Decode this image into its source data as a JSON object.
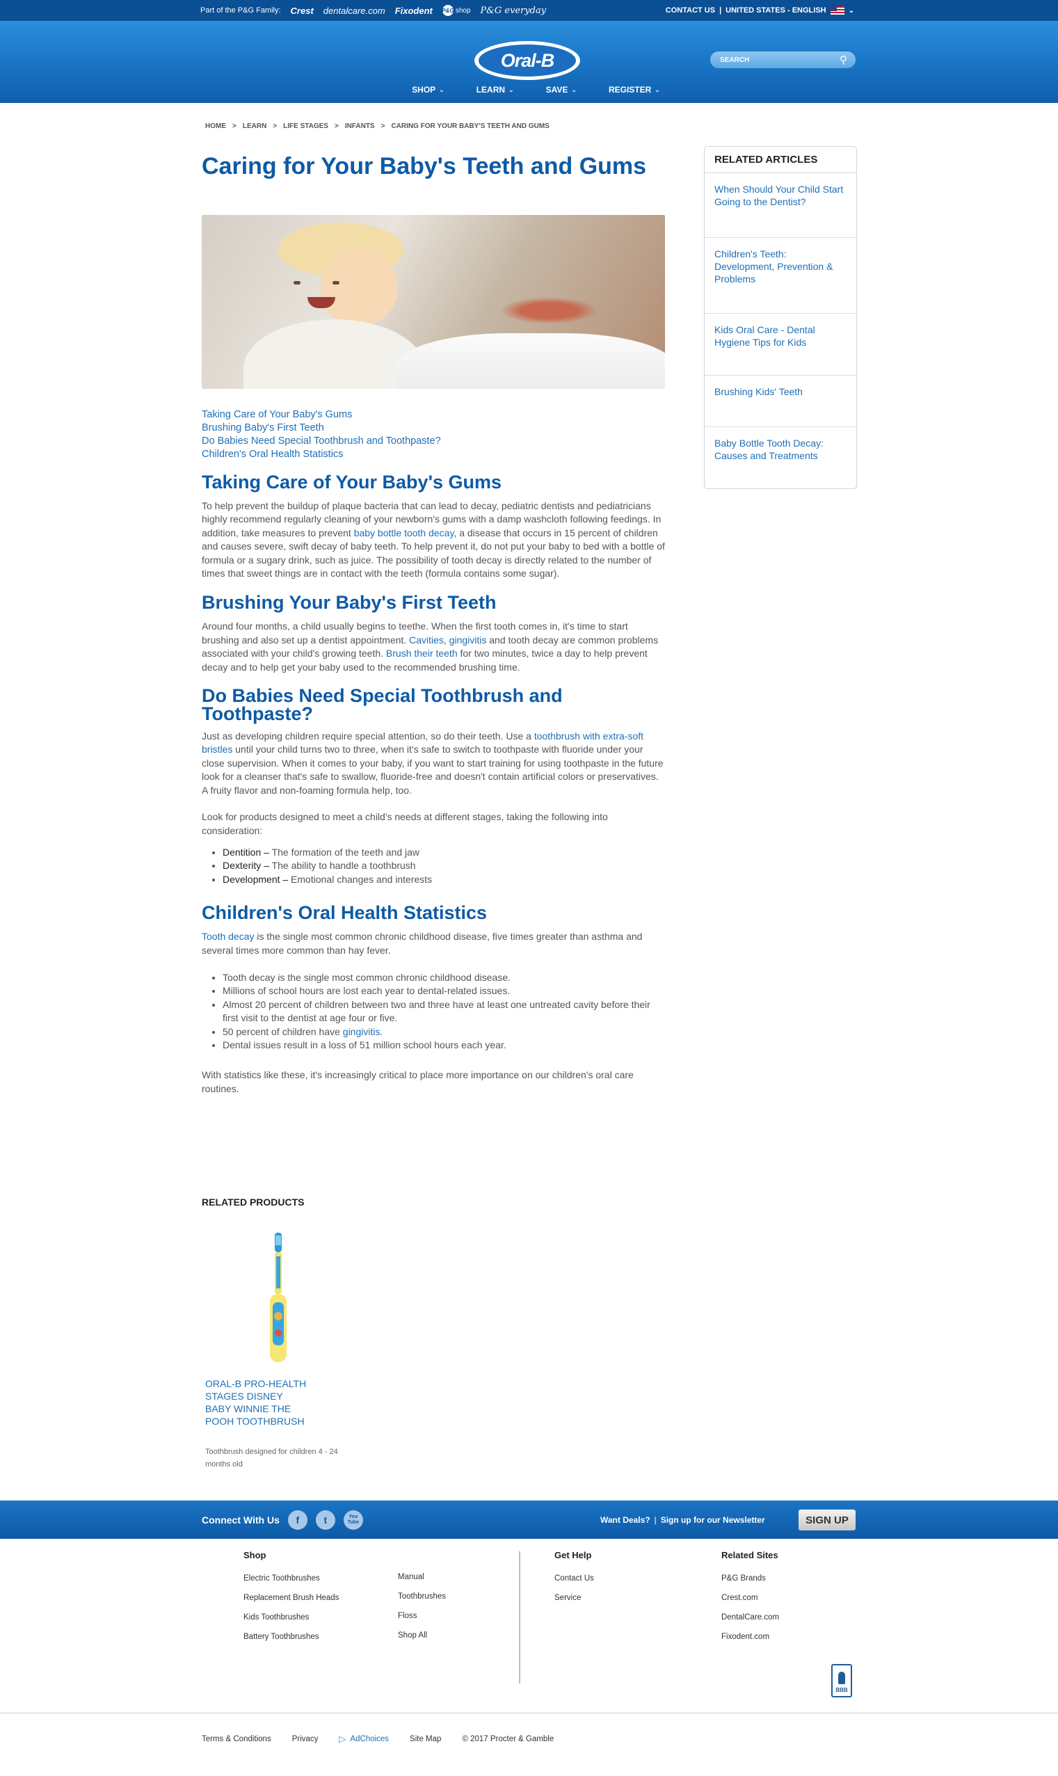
{
  "topbar": {
    "family_label": "Part of the P&G Family:",
    "brands": [
      "Crest",
      "dentalcare.com",
      "Fixodent",
      "P&G shop",
      "P&G everyday"
    ],
    "contact": "CONTACT US",
    "separator": "|",
    "region": "UNITED STATES - ENGLISH"
  },
  "header": {
    "logo": "Oral-B",
    "search_placeholder": "SEARCH",
    "nav": [
      "SHOP",
      "LEARN",
      "SAVE",
      "REGISTER"
    ]
  },
  "breadcrumb": [
    "HOME",
    ">",
    "LEARN",
    ">",
    "LIFE STAGES",
    ">",
    "INFANTS",
    ">",
    "CARING FOR YOUR BABY'S TEETH AND GUMS"
  ],
  "article": {
    "title": "Caring for Your Baby's Teeth and Gums",
    "toc": [
      "Taking Care of Your Baby's Gums",
      "Brushing Baby's First Teeth",
      "Do Babies Need Special Toothbrush and Toothpaste?",
      "Children's Oral Health Statistics"
    ],
    "s1": {
      "heading": "Taking Care of Your Baby's Gums",
      "p_a": "To help prevent the buildup of plaque bacteria that can lead to decay, pediatric dentists and pediatricians highly recommend regularly cleaning of your newborn's gums with a damp washcloth following feedings. In addition, take measures to prevent ",
      "link": "baby bottle tooth decay",
      "p_b": ", a disease that occurs in 15 percent of children and causes severe, swift decay of baby teeth. To help prevent it, do not put your baby to bed with a bottle of formula or a sugary drink, such as juice. The possibility of tooth decay is directly related to the number of times that sweet things are in contact with the teeth (formula contains some sugar)."
    },
    "s2": {
      "heading": "Brushing Your Baby's First Teeth",
      "p_a": "Around four months, a child usually begins to teethe. When the first tooth comes in, it's time to start brushing and also set up a dentist appointment. ",
      "link1": "Cavities",
      "comma": ", ",
      "link2": "gingivitis",
      "p_b": " and tooth decay are common problems associated with your child's growing teeth. ",
      "link3": "Brush their teeth",
      "p_c": " for two minutes, twice a day to help prevent decay and to help get your baby used to the recommended brushing time."
    },
    "s3": {
      "heading": "Do Babies Need Special Toothbrush and Toothpaste?",
      "p_a": "Just as developing children require special attention, so do their teeth. Use a ",
      "link": "toothbrush with extra-soft bristles",
      "p_b": " until your child turns two to three, when it's safe to switch to toothpaste with fluoride under your close supervision. When it comes to your baby, if you want to start training for using toothpaste in the future look for a cleanser that's safe to swallow, fluoride-free and doesn't contain artificial colors or preservatives. A fruity flavor and non-foaming formula help, too.",
      "p2": "Look for products designed to meet a child's needs at different stages, taking the following into consideration:",
      "bullets": [
        {
          "term": "Dentition –",
          "text": " The formation of the teeth and jaw"
        },
        {
          "term": "Dexterity –",
          "text": " The ability to handle a toothbrush"
        },
        {
          "term": "Development –",
          "text": " Emotional changes and interests"
        }
      ]
    },
    "s4": {
      "heading": "Children's Oral Health Statistics",
      "link": "Tooth decay",
      "p_a": " is the single most common chronic childhood disease, five times greater than asthma and several times more common than hay fever.",
      "bullets": [
        "Tooth decay is the single most common chronic childhood disease.",
        "Millions of school hours are lost each year to dental-related issues.",
        "Almost 20 percent of children between two and three have at least one untreated cavity before their first visit to the dentist at age four or five."
      ],
      "b4_a": "50 percent of children have ",
      "b4_link": "gingivitis",
      "b4_b": ".",
      "b5": "Dental issues result in a loss of 51 million school hours each year.",
      "closing": "With statistics like these, it's increasingly critical to place more importance on our children's oral care routines."
    }
  },
  "related_products": {
    "title": "RELATED PRODUCTS",
    "name": "ORAL-B PRO-HEALTH STAGES DISNEY BABY WINNIE THE POOH TOOTHBRUSH",
    "desc": "Toothbrush designed for children 4 - 24 months old"
  },
  "sidebar": {
    "title": "RELATED ARTICLES",
    "items": [
      "When Should Your Child Start Going to the Dentist?",
      "Children's Teeth: Development, Prevention & Problems",
      "Kids Oral Care - Dental Hygiene Tips for Kids",
      "Brushing Kids' Teeth",
      "Baby Bottle Tooth Decay: Causes and Treatments"
    ]
  },
  "footer": {
    "connect": "Connect With Us",
    "social": [
      "f",
      "t",
      "You Tube"
    ],
    "want_deals": "Want Deals?",
    "sep": "|",
    "newsletter": "Sign up for our Newsletter",
    "signup": "SIGN UP",
    "shop_title": "Shop",
    "shop_col1": [
      "Electric Toothbrushes",
      "Replacement Brush Heads",
      "Kids Toothbrushes",
      "Battery Toothbrushes"
    ],
    "shop_col2": [
      "Manual",
      "Toothbrushes",
      "Floss",
      "Shop All"
    ],
    "help_title": "Get Help",
    "help": [
      "Contact Us",
      "Service"
    ],
    "related_title": "Related Sites",
    "related": [
      "P&G Brands",
      "Crest.com",
      "DentalCare.com",
      "Fixodent.com"
    ],
    "bbb": "BBB",
    "legal": [
      "Terms & Conditions",
      "Privacy",
      "AdChoices",
      "Site Map",
      "© 2017 Procter & Gamble"
    ]
  },
  "colors": {
    "brand_blue": "#0b4f95",
    "heading_blue": "#0e5aa6",
    "link_blue": "#1f6fb5"
  }
}
